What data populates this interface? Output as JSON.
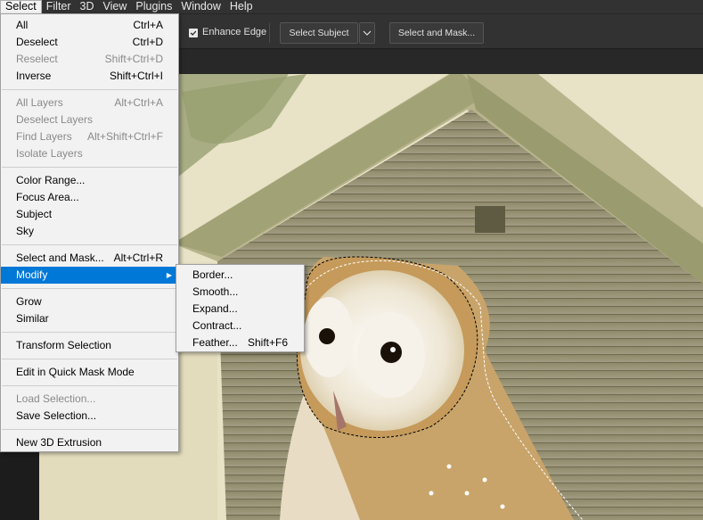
{
  "menubar": [
    {
      "label": "Select",
      "active": true
    },
    {
      "label": "Filter"
    },
    {
      "label": "3D"
    },
    {
      "label": "View"
    },
    {
      "label": "Plugins"
    },
    {
      "label": "Window"
    },
    {
      "label": "Help"
    }
  ],
  "options": {
    "enhance_edge_checked": true,
    "enhance_edge_label": "Enhance Edge",
    "select_subject_label": "Select Subject",
    "select_and_mask_label": "Select and Mask..."
  },
  "select_menu": {
    "items": [
      {
        "label": "All",
        "shortcut": "Ctrl+A"
      },
      {
        "label": "Deselect",
        "shortcut": "Ctrl+D"
      },
      {
        "label": "Reselect",
        "shortcut": "Shift+Ctrl+D",
        "disabled": true
      },
      {
        "label": "Inverse",
        "shortcut": "Shift+Ctrl+I"
      },
      {
        "label": "All Layers",
        "shortcut": "Alt+Ctrl+A",
        "disabled": true
      },
      {
        "label": "Deselect Layers",
        "shortcut": "",
        "disabled": true
      },
      {
        "label": "Find Layers",
        "shortcut": "Alt+Shift+Ctrl+F",
        "disabled": true
      },
      {
        "label": "Isolate Layers",
        "shortcut": "",
        "disabled": true
      },
      {
        "label": "Color Range...",
        "shortcut": ""
      },
      {
        "label": "Focus Area...",
        "shortcut": ""
      },
      {
        "label": "Subject",
        "shortcut": ""
      },
      {
        "label": "Sky",
        "shortcut": ""
      },
      {
        "label": "Select and Mask...",
        "shortcut": "Alt+Ctrl+R"
      },
      {
        "label": "Modify",
        "shortcut": "",
        "highlighted": true,
        "has_submenu": true
      },
      {
        "label": "Grow",
        "shortcut": ""
      },
      {
        "label": "Similar",
        "shortcut": ""
      },
      {
        "label": "Transform Selection",
        "shortcut": ""
      },
      {
        "label": "Edit in Quick Mask Mode",
        "shortcut": ""
      },
      {
        "label": "Load Selection...",
        "shortcut": "",
        "disabled": true
      },
      {
        "label": "Save Selection...",
        "shortcut": ""
      },
      {
        "label": "New 3D Extrusion",
        "shortcut": ""
      }
    ]
  },
  "modify_submenu": {
    "items": [
      {
        "label": "Border...",
        "shortcut": ""
      },
      {
        "label": "Smooth...",
        "shortcut": ""
      },
      {
        "label": "Expand...",
        "shortcut": ""
      },
      {
        "label": "Contract...",
        "shortcut": ""
      },
      {
        "label": "Feather...",
        "shortcut": "Shift+F6"
      }
    ]
  },
  "colors": {
    "menu_bg": "#f2f2f2",
    "highlight": "#0078d7",
    "ui_dark": "#323232"
  }
}
